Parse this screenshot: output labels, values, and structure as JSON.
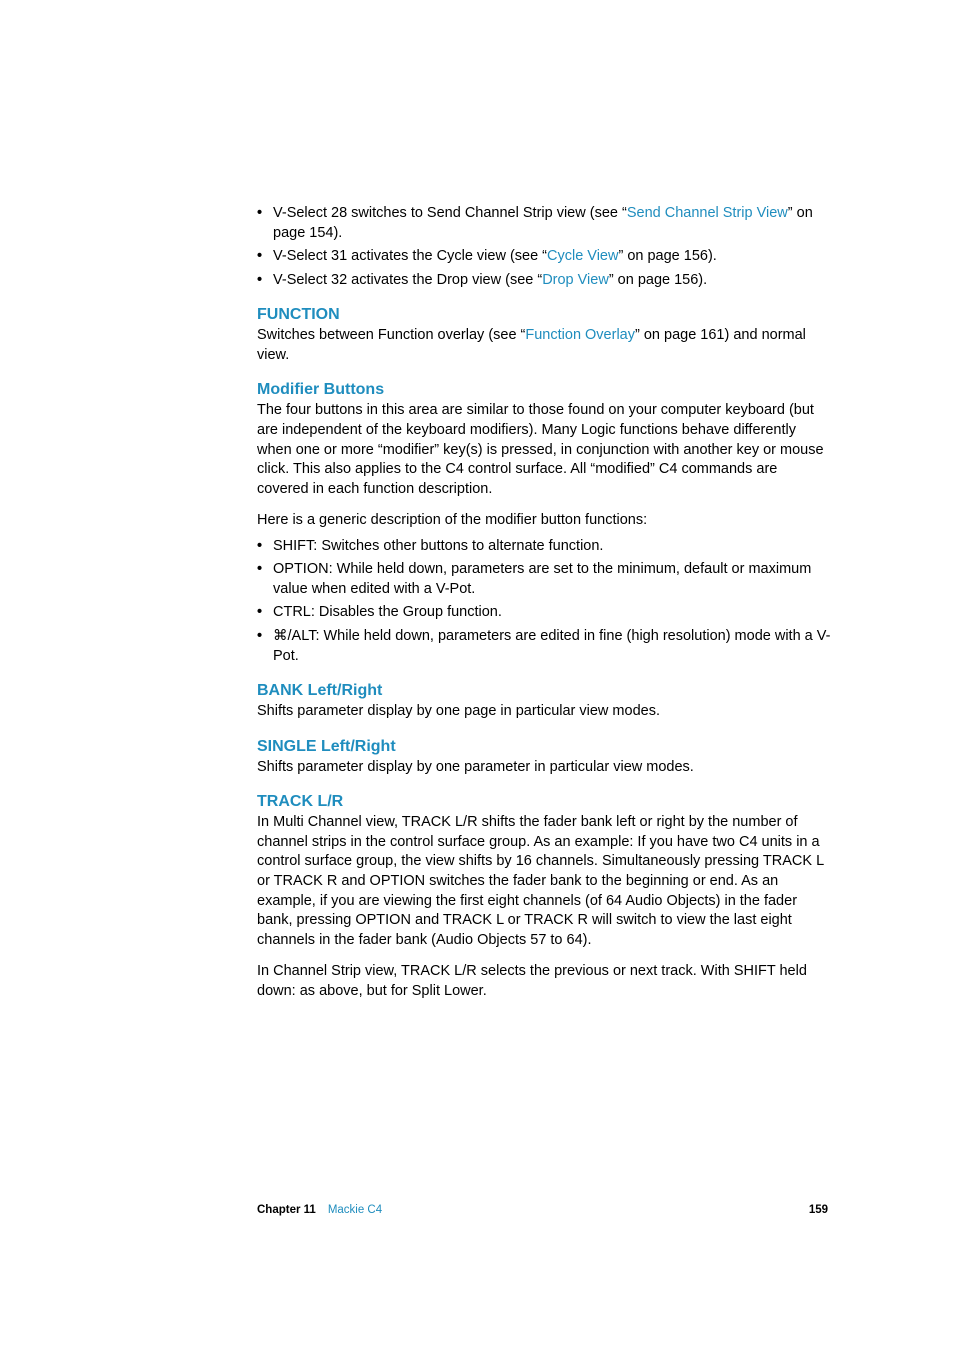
{
  "bullets_top": [
    {
      "pre": "V-Select 28 switches to Send Channel Strip view (see “",
      "link": "Send Channel Strip View",
      "post": "” on page 154)."
    },
    {
      "pre": "V-Select 31 activates the Cycle view (see “",
      "link": "Cycle View",
      "post": "” on page 156)."
    },
    {
      "pre": "V-Select 32 activates the Drop view (see “",
      "link": "Drop View",
      "post": "” on page 156)."
    }
  ],
  "function": {
    "heading": "FUNCTION",
    "pre": "Switches between Function overlay (see “",
    "link": "Function Overlay",
    "post": "” on page 161) and normal view."
  },
  "modifier": {
    "heading": "Modifier Buttons",
    "para1": "The four buttons in this area are similar to those found on your computer keyboard (but are independent of the keyboard modifiers). Many Logic functions behave differently when one or more “modifier” key(s) is pressed, in conjunction with another key or mouse click. This also applies to the C4 control surface. All “modified” C4 commands are covered in each function description.",
    "para2": "Here is a generic description of the modifier button functions:",
    "items": [
      "SHIFT:  Switches other buttons to alternate function.",
      "OPTION:  While held down, parameters are set to the minimum, default or maximum value when edited with a V-Pot.",
      "CTRL:  Disables the Group function.",
      "⌘/ALT:  While held down, parameters are edited in fine (high resolution) mode with a V-Pot."
    ]
  },
  "bank": {
    "heading": "BANK Left/Right",
    "para": "Shifts parameter display by one page in particular view modes."
  },
  "single": {
    "heading": "SINGLE Left/Right",
    "para": "Shifts parameter display by one parameter in particular view modes."
  },
  "track": {
    "heading": "TRACK L/R",
    "para1": "In Multi Channel view, TRACK L/R shifts the fader bank left or right by the number of channel strips in the control surface group. As an example:  If you have two C4 units in a control surface group, the view shifts by 16 channels. Simultaneously pressing TRACK L or TRACK R and OPTION switches the fader bank to the beginning or end. As an example, if you are viewing the first eight channels (of 64 Audio Objects) in the fader bank, pressing OPTION and TRACK L or TRACK R will switch to view the last eight channels in the fader bank (Audio Objects 57 to 64).",
    "para2": "In Channel Strip view, TRACK L/R selects the previous or next track. With SHIFT held down:  as above, but for Split Lower."
  },
  "footer": {
    "chapter": "Chapter 11",
    "title": "Mackie C4",
    "page": "159"
  }
}
